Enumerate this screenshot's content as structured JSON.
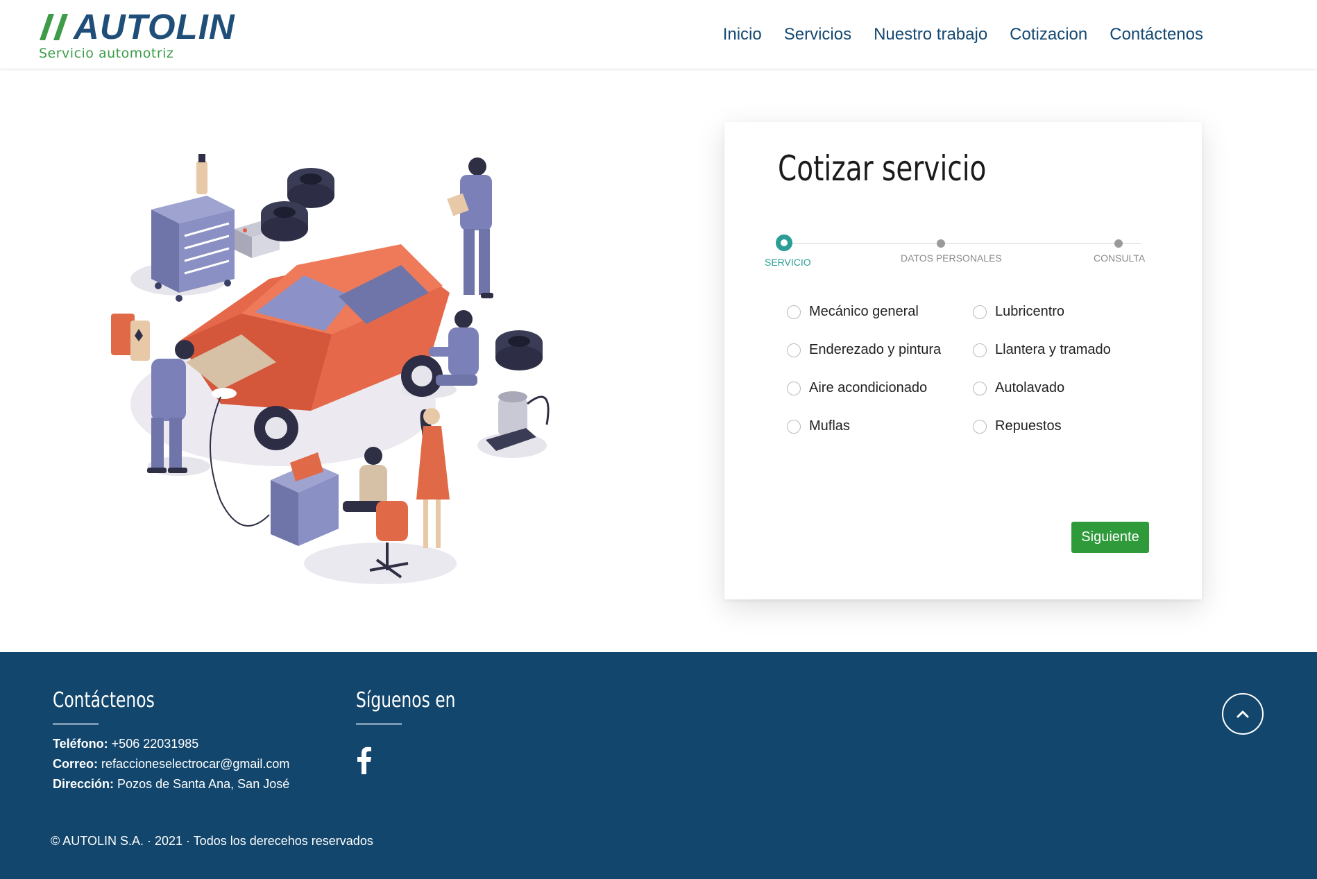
{
  "brand": {
    "name": "AUTOLIN",
    "tagline": "Servicio automotriz",
    "primary_color": "#1f4e79",
    "accent_color": "#3d9b49"
  },
  "nav": {
    "items": [
      "Inicio",
      "Servicios",
      "Nuestro trabajo",
      "Cotizacion",
      "Contáctenos"
    ]
  },
  "illustration": {
    "icon": "car-workshop-illustration"
  },
  "quote": {
    "title": "Cotizar servicio",
    "steps": [
      {
        "label": "SERVICIO",
        "active": true
      },
      {
        "label": "DATOS PERSONALES",
        "active": false
      },
      {
        "label": "CONSULTA",
        "active": false
      }
    ],
    "options": [
      "Mecánico general",
      "Lubricentro",
      "Enderezado y pintura",
      "Llantera y tramado",
      "Aire acondicionado",
      "Autolavado",
      "Muflas",
      "Repuestos"
    ],
    "next_label": "Siguiente",
    "active_color": "#2a9d95",
    "button_color": "#2e9a3a"
  },
  "footer": {
    "contact_heading": "Contáctenos",
    "social_heading": "Síguenos en",
    "phone_label": "Teléfono:",
    "phone": "+506 22031985",
    "email_label": "Correo:",
    "email": "refaccioneselectrocar@gmail.com",
    "address_label": "Dirección:",
    "address": "Pozos de Santa Ana, San José",
    "copyright": "© AUTOLIN S.A. · 2021 · Todos los derecehos reservados",
    "social_icon": "facebook-icon",
    "background": "#12466c"
  }
}
